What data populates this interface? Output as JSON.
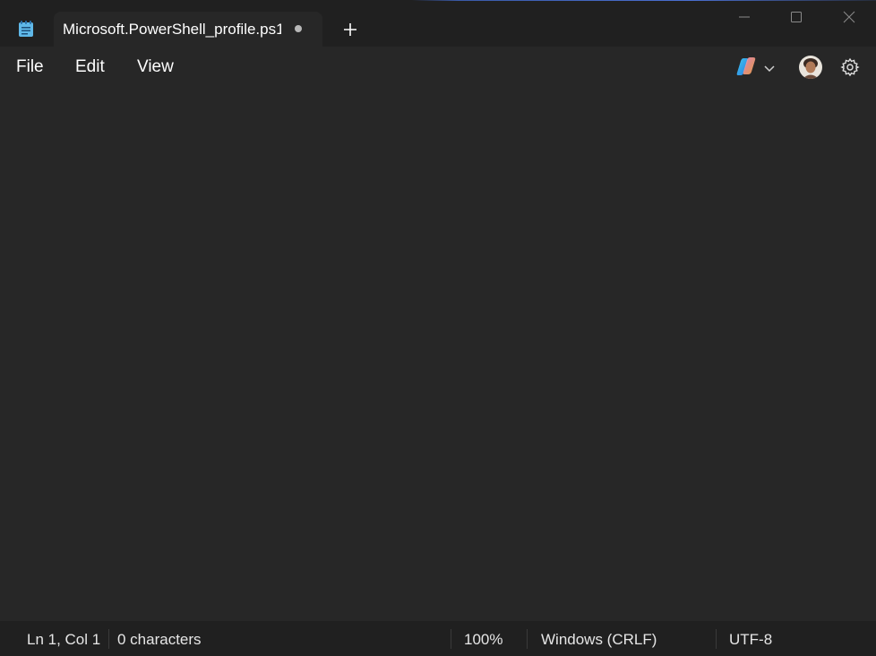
{
  "tab": {
    "title": "Microsoft.PowerShell_profile.ps1",
    "unsaved_indicator": true
  },
  "icons": {
    "app": "notepad-icon",
    "new_tab": "plus-icon",
    "minimize": "minimize-icon",
    "maximize": "maximize-icon",
    "close": "close-icon",
    "copilot": "copilot-icon",
    "copilot_dropdown": "chevron-down-icon",
    "account": "avatar",
    "settings": "gear-icon"
  },
  "menu": {
    "file": "File",
    "edit": "Edit",
    "view": "View"
  },
  "editor": {
    "content": ""
  },
  "status": {
    "position": "Ln 1, Col 1",
    "characters": "0 characters",
    "zoom": "100%",
    "line_endings": "Windows (CRLF)",
    "encoding": "UTF-8"
  },
  "colors": {
    "background": "#202020",
    "surface": "#272727",
    "text": "#ffffff",
    "accent_top": "#4a6fd0"
  }
}
